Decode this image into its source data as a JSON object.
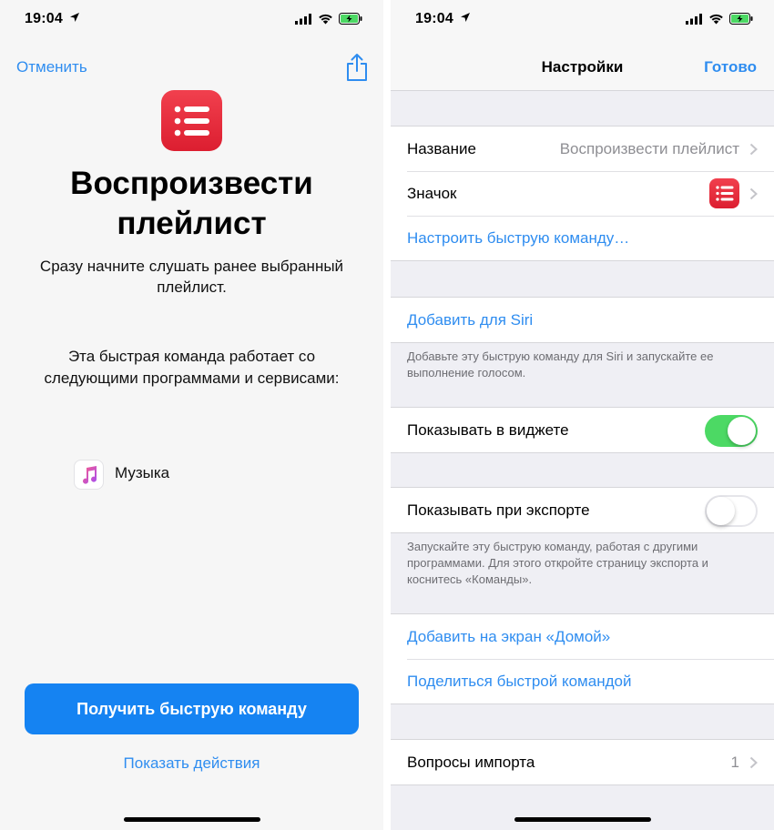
{
  "left": {
    "status": {
      "time": "19:04"
    },
    "cancel_label": "Отменить",
    "title": "Воспроизвести плейлист",
    "description": "Сразу начните слушать ранее выбранный плейлист.",
    "works_with_text": "Эта быстрая команда работает со следующими программами и сервисами:",
    "apps": [
      {
        "label": "Музыка",
        "icon": "music-note-icon"
      }
    ],
    "get_button_label": "Получить быструю команду",
    "show_actions_label": "Показать действия"
  },
  "right": {
    "status": {
      "time": "19:04"
    },
    "nav": {
      "title": "Настройки",
      "done_label": "Готово"
    },
    "rows": {
      "name_label": "Название",
      "name_value": "Воспроизвести плейлист",
      "icon_label": "Значок",
      "configure_label": "Настроить быструю команду…",
      "add_siri_label": "Добавить для Siri",
      "siri_footer": "Добавьте эту быструю команду для Siri и запускайте ее выполнение голосом.",
      "widget_label": "Показывать в виджете",
      "widget_on": true,
      "export_label": "Показывать при экспорте",
      "export_on": false,
      "export_footer": "Запускайте эту быструю команду, работая с другими программами. Для этого откройте страницу экспорта и коснитесь «Команды».",
      "home_label": "Добавить на экран «Домой»",
      "share_label": "Поделиться быстрой командой",
      "import_label": "Вопросы импорта",
      "import_value": "1"
    }
  },
  "colors": {
    "accent": "#2f8df0",
    "button": "#1583f2",
    "shortcut_red": "#e52a3a",
    "toggle_on": "#4cd964"
  }
}
